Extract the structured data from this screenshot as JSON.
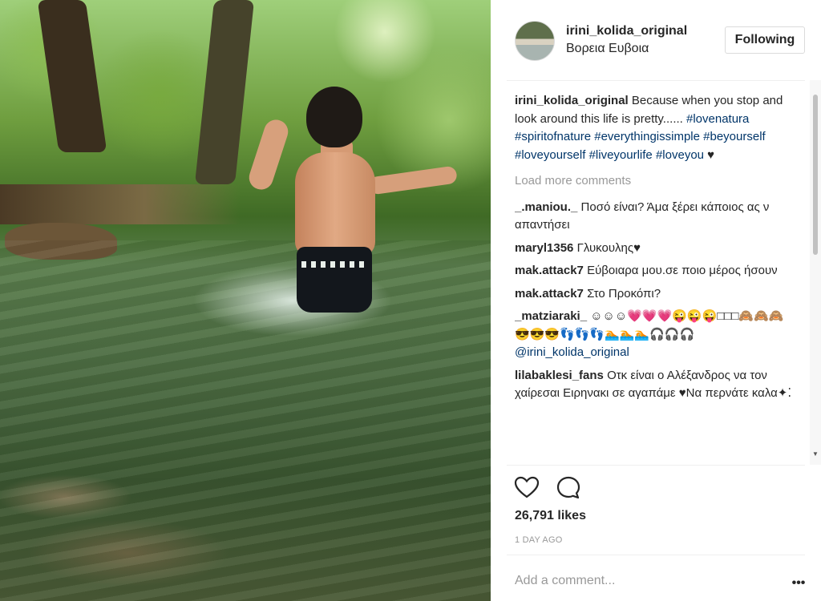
{
  "post": {
    "author": "irini_kolida_original",
    "location": "Βορεια Ευβοια",
    "follow_label": "Following",
    "caption": {
      "user": "irini_kolida_original",
      "text": "Because when you stop and look around this life is pretty......",
      "hashtags": [
        "#lovenatura",
        "#spiritofnature",
        "#everythingissimple",
        "#beyourself",
        "#loveyourself",
        "#liveyourlife",
        "#loveyou"
      ],
      "suffix": "♥"
    },
    "load_more": "Load more comments",
    "comments": [
      {
        "user": "_.maniou._",
        "text": "Ποσό είναι? Άμα ξέρει κάποιος ας ν απαντήσει"
      },
      {
        "user": "maryl1356",
        "text": "Γλυκουλης♥"
      },
      {
        "user": "mak.attack7",
        "text": "Εύβοιαρα μου.σε ποιο μέρος ήσουν"
      },
      {
        "user": "mak.attack7",
        "text": "Στο Προκόπι?"
      },
      {
        "user": "_matziaraki_",
        "text": "☺☺☺💗💗💗😜😜😜□□□🙈🙈🙈😎😎😎👣👣👣🏊🏊🏊🎧🎧🎧",
        "mention": "@irini_kolida_original"
      },
      {
        "user": "lilabaklesi_fans",
        "text": "Οτκ είναι ο Αλέξανδρος να τον χαίρεσαι Ειρηνακι σε αγαπάμε ♥Να περνάτε καλα✦⁚"
      }
    ],
    "likes": "26,791 likes",
    "time": "1 DAY AGO",
    "add_comment_placeholder": "Add a comment...",
    "more_label": "•••"
  },
  "icons": {
    "like": "heart-icon",
    "comment": "comment-bubble-icon",
    "more": "more-options-icon"
  },
  "colors": {
    "link": "#003569",
    "muted": "#999999",
    "text": "#262626",
    "border": "#dbdbdb"
  }
}
